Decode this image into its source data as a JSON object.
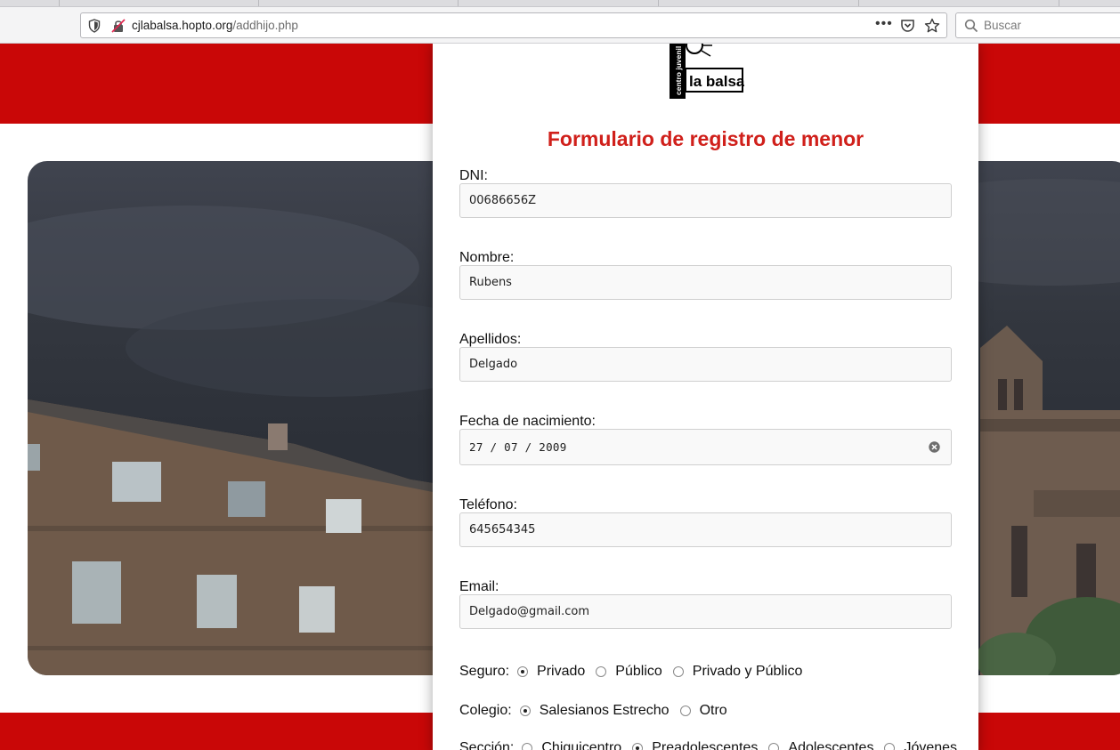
{
  "browser": {
    "url_host": "cjlabalsa.hopto.org",
    "url_path": "/addhijo.php",
    "more_label": "•••",
    "search_placeholder": "Buscar"
  },
  "logo": {
    "text_main": "la balsa",
    "text_side": "centro juvenil"
  },
  "form": {
    "title": "Formulario de registro de menor",
    "dni_label": "DNI:",
    "dni_value": "00686656Z",
    "nombre_label": "Nombre:",
    "nombre_value": "Rubens",
    "apellidos_label": "Apellidos:",
    "apellidos_value": "Delgado",
    "fecha_label": "Fecha de nacimiento:",
    "fecha_value": "27 / 07 / 2009",
    "telefono_label": "Teléfono:",
    "telefono_value": "645654345",
    "email_label": "Email:",
    "email_value": "Delgado@gmail.com",
    "seguro": {
      "label": "Seguro:",
      "options": [
        "Privado",
        "Público",
        "Privado y Público"
      ],
      "selected": "Privado"
    },
    "colegio": {
      "label": "Colegio:",
      "options": [
        "Salesianos Estrecho",
        "Otro"
      ],
      "selected": "Salesianos Estrecho"
    },
    "seccion": {
      "label": "Sección:",
      "options": [
        "Chiquicentro",
        "Preadolescentes",
        "Adolescentes",
        "Jóvenes"
      ],
      "selected": "Preadolescentes"
    }
  },
  "colors": {
    "brand_red": "#c90707",
    "title_red": "#d0201b"
  }
}
